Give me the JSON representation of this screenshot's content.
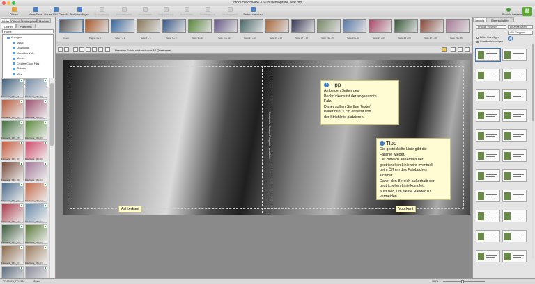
{
  "window": {
    "title": "fotobuchsoftware 3.6.0b Demografie Test.dfpj"
  },
  "toolbar": [
    {
      "label": "Öffnen",
      "color": "#e6a23c",
      "disabled": false
    },
    {
      "label": "Neue Seite",
      "color": "#4a7fc1",
      "disabled": false
    },
    {
      "label": "Neues Bild-Gestalt",
      "color": "#4a7fc1",
      "disabled": false
    },
    {
      "label": "Text hinzufügen",
      "color": "#4a7fc1",
      "disabled": false
    },
    {
      "label": "Rückgängig",
      "disabled": true
    },
    {
      "label": "Wiederholen",
      "disabled": true
    },
    {
      "label": "Gruppieren",
      "disabled": true
    },
    {
      "label": "Gruppierung aufheben",
      "disabled": true
    },
    {
      "label": "Ausrichten",
      "disabled": true
    },
    {
      "label": "Vordergrund",
      "disabled": true
    },
    {
      "label": "Hintergrund",
      "disabled": true
    },
    {
      "label": "Seitenvorschau",
      "color": "#4a7fc1",
      "disabled": false
    }
  ],
  "product_button": "Produkt bestellen",
  "logo": "ff",
  "left": {
    "tabs": [
      "Bilder",
      "Cliparts",
      "Hintergründe",
      "Masken"
    ],
    "subtabs": [
      "Ordner",
      "Plattenen"
    ],
    "folder_select": "Home",
    "tree": [
      "Anzeigen",
      "Music",
      "Downloads",
      "VirtualBox VMs",
      "Movies",
      "Creative Cloud Files",
      "Pictures",
      "VMs",
      "Desktop",
      "Documents"
    ],
    "photos": [
      "Fotofuella_IMG_01",
      "Fotofuella_IMG_02",
      "Fotofuella_IMG_03",
      "Fotofuella_IMG_04",
      "Fotofuella_IMG_05",
      "Fotofuella_IMG_06",
      "Fotofuella_IMG_07",
      "Fotofuella_IMG_08",
      "Fotofuella_IMG_09",
      "Fotofuella_IMG_10",
      "Fotofuella_IMG_11",
      "Fotofuella_IMG_12",
      "Fotofuella_IMG_13",
      "Fotofuella_IMG_14",
      "Fotofuella_IMG_15",
      "Fotofuella_IMG_16",
      "Fotofuella_IMG_17",
      "Fotofuella_IMG_18",
      "Fotofuella_IMG_19",
      "Fotofuella_IMG_20"
    ]
  },
  "strip": [
    "Cover",
    "Pagina 1 + 2",
    "Seite 3 + 4",
    "Seite 5 + 6",
    "Seite 7 + 8",
    "Seite 9 + 10",
    "Seite 11 + 12",
    "Seite 13 + 14",
    "Seite 15 + 16",
    "Seite 17 + 18",
    "Seite 19 + 20",
    "Seite 21 + 22",
    "Seite 23 + 24",
    "Seite 25 + 26",
    "Seite 27 + 28",
    "Seite 29 + 30"
  ],
  "editor": {
    "product_title": "Premium Fotobuch Hardcover A4 Querformat"
  },
  "spine_text": "Demografie · Analoge Fotografie · Anja Kohn",
  "tips": {
    "tip1": {
      "heading": "Tipp",
      "lines": [
        "An beiden Seiten des",
        "Buchrückens ist der sogenannte",
        "Falz.",
        "Daher sollten Sie Ihre Texte/",
        "Bilder min. 1 cm entfernt von",
        "der Strichlinie platzieren."
      ]
    },
    "tip2": {
      "heading": "Tipp",
      "lines": [
        "Die gestrichelte Linie gibt die",
        "Faltlinie wieder.",
        "Der Bereich außerhalb der",
        "gestrichelten Linie wird eventuell",
        "beim Öffnen des Fotobuches",
        "sichtbar.",
        "Daher den Bereich außerhalb der",
        "gestrichelten Linie komplett",
        "ausfüllen, um weiße Ränder zu",
        "vermeiden."
      ]
    }
  },
  "labels": {
    "back": "Achterkant",
    "front": "Voorkant"
  },
  "right": {
    "tabs": [
      "Layouts",
      "Eigenschaften"
    ],
    "select1": "Produkt Vorlagen",
    "select2": "Einzelne Seiten",
    "select3": "Alle Gruppen",
    "check1": "Bilder hinzufügen",
    "check2": "Schriften hinzufügen"
  },
  "status": {
    "left": "FF-00378_PF-1904",
    "center": "Cover",
    "zoom": "100%"
  }
}
